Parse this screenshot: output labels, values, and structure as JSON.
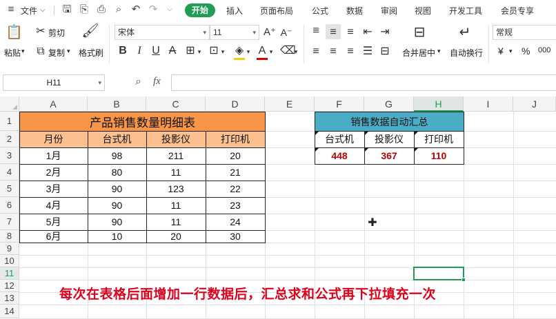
{
  "menubar": {
    "file_label": "文件",
    "tabs": [
      "开始",
      "插入",
      "页面布局",
      "公式",
      "数据",
      "审阅",
      "视图",
      "开发工具",
      "会员专享"
    ]
  },
  "ribbon": {
    "cut_label": "剪切",
    "copy_label": "复制",
    "paste_label": "粘贴",
    "format_painter_label": "格式刷",
    "font_name": "宋体",
    "font_size": "11",
    "merge_label": "合并居中",
    "wrap_label": "自动换行",
    "number_format": "常规",
    "currency_symbol": "¥",
    "percent_symbol": "%",
    "thousands_symbol": "000"
  },
  "formula_bar": {
    "cell_ref": "H11",
    "fx_label": "fx",
    "value": ""
  },
  "sheet": {
    "columns": [
      "A",
      "B",
      "C",
      "D",
      "E",
      "F",
      "G",
      "H",
      "I",
      "J"
    ],
    "rows": [
      "1",
      "2",
      "3",
      "4",
      "5",
      "6",
      "7",
      "8",
      "9",
      "10",
      "11",
      "12",
      "13",
      "14"
    ],
    "detail_table": {
      "title": "产品销售数量明细表",
      "headers": [
        "月份",
        "台式机",
        "投影仪",
        "打印机"
      ],
      "rows": [
        [
          "1月",
          "98",
          "211",
          "20"
        ],
        [
          "2月",
          "80",
          "11",
          "21"
        ],
        [
          "3月",
          "90",
          "123",
          "22"
        ],
        [
          "4月",
          "90",
          "11",
          "23"
        ],
        [
          "5月",
          "90",
          "11",
          "24"
        ],
        [
          "6月",
          "10",
          "20",
          "30"
        ]
      ]
    },
    "summary_table": {
      "title": "销售数据自动汇总",
      "headers": [
        "台式机",
        "投影仪",
        "打印机"
      ],
      "values": [
        "448",
        "367",
        "110"
      ]
    },
    "caption": "每次在表格后面增加一行数据后，汇总求和公式再下拉填充一次"
  },
  "colors": {
    "accent": "#1e9e55",
    "detail_title_bg": "#f79646",
    "detail_header_bg": "#fac08f",
    "summary_title_bg": "#4bacc6",
    "summary_value": "#c00000",
    "caption": "#e0001b"
  }
}
